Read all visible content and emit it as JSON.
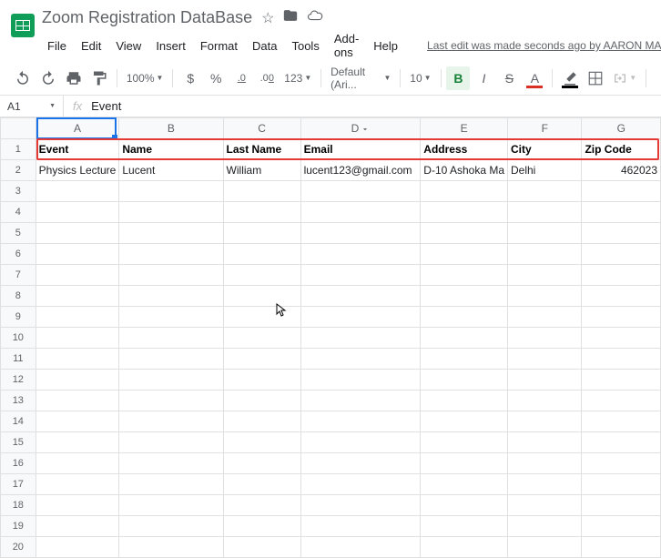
{
  "doc": {
    "title": "Zoom Registration DataBase"
  },
  "menu": {
    "file": "File",
    "edit": "Edit",
    "view": "View",
    "insert": "Insert",
    "format": "Format",
    "data": "Data",
    "tools": "Tools",
    "addons": "Add-ons",
    "help": "Help",
    "lastEdit": "Last edit was made seconds ago by AARON MANUE"
  },
  "toolbar": {
    "zoom": "100%",
    "font": "Default (Ari...",
    "fontSize": "10",
    "currency": "$",
    "percent": "%",
    "decDec": ".0",
    "incDec": ".00",
    "numFmt": "123",
    "bold": "B",
    "italic": "I",
    "strike": "S",
    "textColor": "A"
  },
  "nameBox": "A1",
  "formula": "Event",
  "cols": [
    "A",
    "B",
    "C",
    "D",
    "E",
    "F",
    "G"
  ],
  "headers": {
    "A": "Event",
    "B": "Name",
    "C": "Last Name",
    "D": "Email",
    "E": "Address",
    "F": "City",
    "G": "Zip Code"
  },
  "row2": {
    "A": "Physics Lecture",
    "B": "Lucent",
    "C": "William",
    "D": "lucent123@gmail.com",
    "E": "D-10 Ashoka Ma",
    "F": "Delhi",
    "G": "462023"
  }
}
